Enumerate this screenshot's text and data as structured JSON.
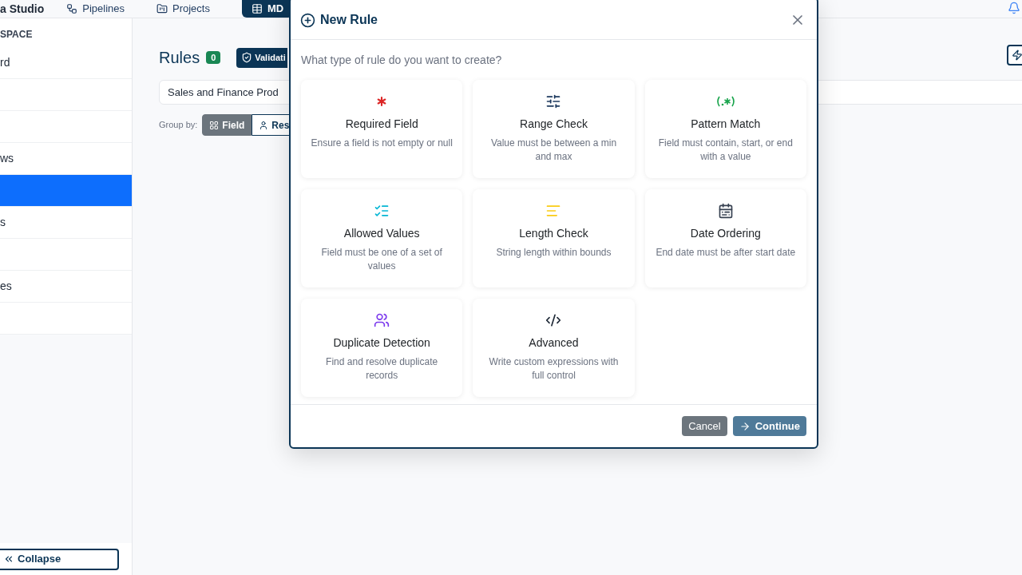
{
  "topbar": {
    "brand": "a Studio",
    "nav": [
      {
        "label": "Pipelines",
        "selected": false
      },
      {
        "label": "Projects",
        "selected": false
      },
      {
        "label": "MD",
        "selected": true
      }
    ]
  },
  "sidebar": {
    "heading": "SPACE",
    "items": [
      {
        "label": "rd",
        "selected": false
      },
      {
        "selected": false
      },
      {
        "selected": false
      },
      {
        "label": "ws",
        "selected": false
      },
      {
        "selected": true
      },
      {
        "label": "s",
        "selected": false
      },
      {
        "selected": false
      },
      {
        "label": "es",
        "selected": false
      },
      {
        "selected": false
      }
    ],
    "collapse": "Collapse"
  },
  "main": {
    "title": "Rules",
    "count": "0",
    "validation_button": "Validati",
    "search": {
      "value": "Sales and Finance Prod"
    },
    "group_by": {
      "label": "Group by:",
      "options": [
        {
          "label": "Field",
          "selected": true
        },
        {
          "label": "Res",
          "selected": false
        }
      ]
    }
  },
  "dialog": {
    "title": "New Rule",
    "prompt": "What type of rule do you want to create?",
    "types": [
      {
        "kind": "required",
        "title": "Required Field",
        "description": "Ensure a field is not empty or null"
      },
      {
        "kind": "range",
        "title": "Range Check",
        "description": "Value must be between a min and max"
      },
      {
        "kind": "pattern",
        "title": "Pattern Match",
        "description": "Field must contain, start, or end with a value"
      },
      {
        "kind": "allowed",
        "title": "Allowed Values",
        "description": "Field must be one of a set of values"
      },
      {
        "kind": "length",
        "title": "Length Check",
        "description": "String length within bounds"
      },
      {
        "kind": "date",
        "title": "Date Ordering",
        "description": "End date must be after start date"
      },
      {
        "kind": "duplicate",
        "title": "Duplicate Detection",
        "description": "Find and resolve duplicate records"
      },
      {
        "kind": "advanced",
        "title": "Advanced",
        "description": "Write custom expressions with full control"
      }
    ],
    "buttons": {
      "cancel": "Cancel",
      "continue": "Continue"
    }
  }
}
